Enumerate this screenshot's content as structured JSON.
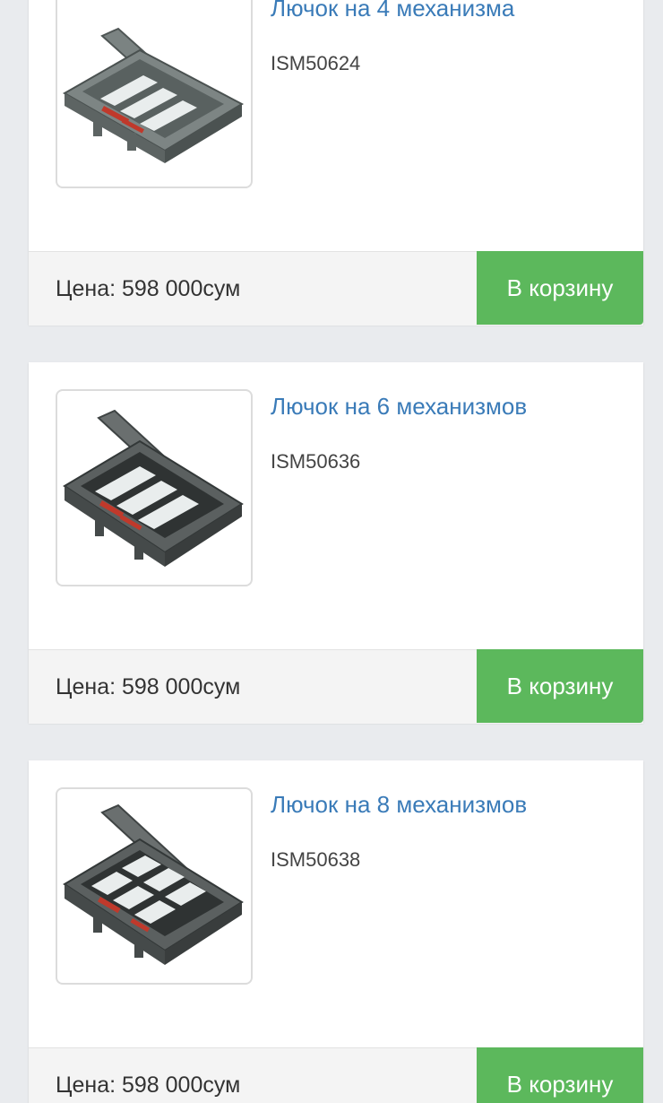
{
  "products": [
    {
      "title": "Лючок на 4 механизма",
      "sku": "ISM50624",
      "price": "Цена: 598 000сум",
      "cart_label": "В корзину",
      "image_icon": "floor-box-4-icon"
    },
    {
      "title": "Лючок на 6 механизмов",
      "sku": "ISM50636",
      "price": "Цена: 598 000сум",
      "cart_label": "В корзину",
      "image_icon": "floor-box-6-icon"
    },
    {
      "title": "Лючок на 8 механизмов",
      "sku": "ISM50638",
      "price": "Цена: 598 000сум",
      "cart_label": "В корзину",
      "image_icon": "floor-box-8-icon"
    }
  ],
  "colors": {
    "background": "#e9ebee",
    "link": "#3a7bb8",
    "button": "#5cb85c"
  }
}
